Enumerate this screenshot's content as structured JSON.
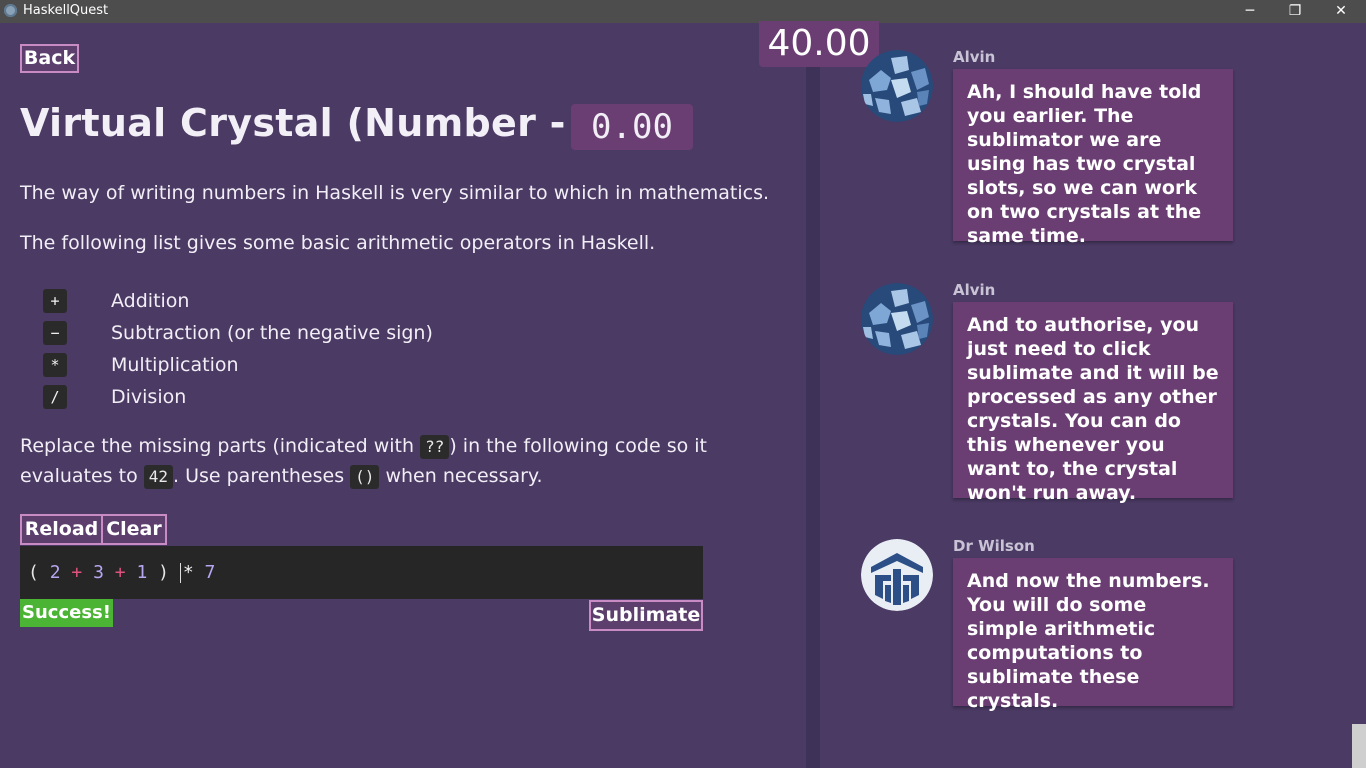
{
  "window": {
    "title": "HaskellQuest",
    "minimize_glyph": "─",
    "maximize_glyph": "❐",
    "close_glyph": "✕"
  },
  "left": {
    "back_label": "Back",
    "title": "Virtual Crystal (Number - 0)",
    "title_score": "0.00",
    "intro1": "The way of writing numbers in Haskell is very similar to which in mathematics.",
    "intro2": "The following list gives some basic arithmetic operators in Haskell.",
    "operators": [
      {
        "symbol": "+",
        "label": "Addition"
      },
      {
        "symbol": "−",
        "label": "Subtraction (or the negative sign)"
      },
      {
        "symbol": "*",
        "label": "Multiplication"
      },
      {
        "symbol": "/",
        "label": "Division"
      }
    ],
    "instr": {
      "a": "Replace the missing parts (indicated with ",
      "chip1": "??",
      "b": ") in the following code so it",
      "c": "evaluates to ",
      "chip2": "42",
      "d": ". Use parentheses ",
      "chip3": "()",
      "e": " when necessary."
    },
    "reload_label": "Reload",
    "clear_label": "Clear",
    "code": {
      "t1": "(",
      "t2": "2",
      "t3": "+",
      "t4": "3",
      "t5": "+",
      "t6": "1",
      "t7": ")",
      "t8": "*",
      "t9": "7"
    },
    "success_label": "Success!",
    "sublimate_label": "Sublimate"
  },
  "top_score": "40.00",
  "chat": [
    {
      "author": "Alvin",
      "avatar": "crystal-avatar-icon",
      "text": "Ah, I should have told you earlier. The sublimator we are using has two crystal slots, so we can work on two crystals at the same time."
    },
    {
      "author": "Alvin",
      "avatar": "crystal-avatar-icon",
      "text": "And to authorise, you just need to click sublimate and it will be processed as any other crystals. You can do this whenever you want to, the crystal won't run away."
    },
    {
      "author": "Dr Wilson",
      "avatar": "robot-avatar-icon",
      "text": "And now the numbers. You will do some simple arithmetic computations to sublimate these crystals."
    }
  ],
  "colors": {
    "background": "#4a3a64",
    "bubble": "#6a3e72",
    "button_border": "#c98bc4",
    "success": "#4cb434",
    "editor": "#262626"
  }
}
